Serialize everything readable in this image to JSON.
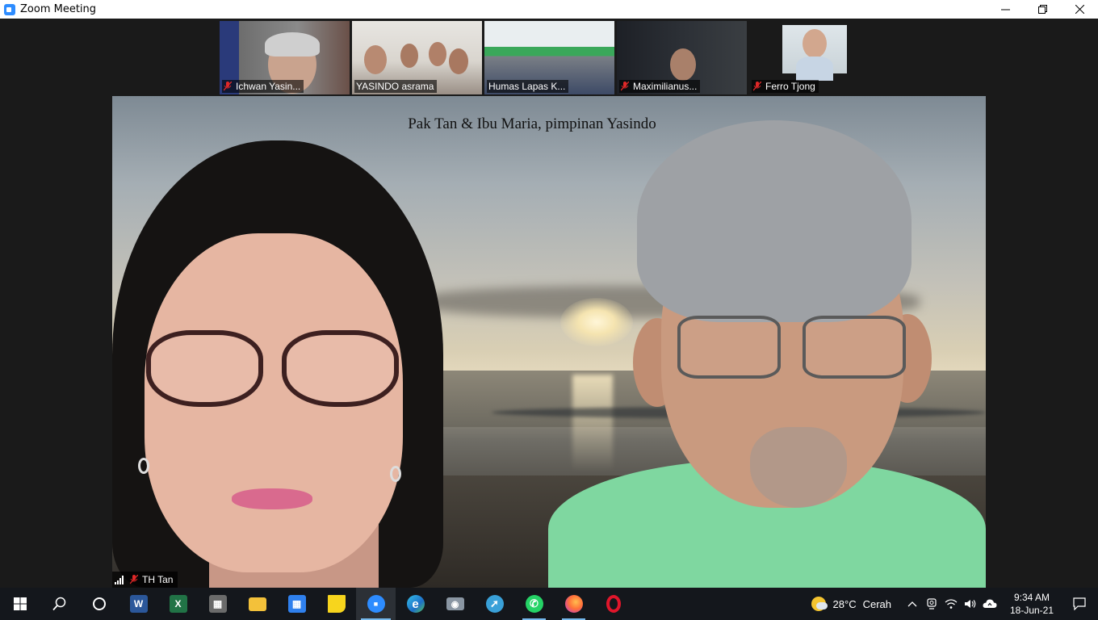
{
  "window": {
    "title": "Zoom Meeting",
    "controls": [
      "minimize-icon",
      "restore-icon",
      "close-icon"
    ]
  },
  "participants": [
    {
      "name": "Ichwan Yasin...",
      "muted": true
    },
    {
      "name": "YASINDO asrama",
      "muted": false
    },
    {
      "name": "Humas Lapas K...",
      "muted": false
    },
    {
      "name": "Maximilianus...",
      "muted": true
    },
    {
      "name": "Ferro Tjong",
      "muted": true
    }
  ],
  "main_video": {
    "caption": "Pak Tan & Ibu Maria, pimpinan Yasindo",
    "speaker": "TH Tan",
    "speaker_muted": true
  },
  "taskbar": {
    "apps": [
      {
        "name": "start-button",
        "icon": "windows-logo-icon"
      },
      {
        "name": "search-button",
        "icon": "search-icon"
      },
      {
        "name": "task-view-button",
        "icon": "cortana-circle-icon"
      },
      {
        "name": "word-app",
        "icon": "word-icon",
        "glyph": "W",
        "color": "#2b579a"
      },
      {
        "name": "excel-app",
        "icon": "excel-icon",
        "glyph": "X",
        "color": "#217346"
      },
      {
        "name": "calculator-app",
        "icon": "calculator-icon",
        "glyph": "▦",
        "color": "#6b6b6b"
      },
      {
        "name": "file-explorer-app",
        "icon": "folder-icon",
        "glyph": "",
        "color": "#f3c13a"
      },
      {
        "name": "calendar-app",
        "icon": "calendar-icon",
        "glyph": "▦",
        "color": "#2f80ed"
      },
      {
        "name": "sticky-notes-app",
        "icon": "sticky-note-icon",
        "glyph": "",
        "color": "#f7d51d"
      },
      {
        "name": "zoom-app",
        "icon": "zoom-camera-icon",
        "glyph": "■",
        "color": "#2d8cff"
      },
      {
        "name": "edge-app",
        "icon": "edge-icon",
        "glyph": "e",
        "color": "#1e90c8"
      },
      {
        "name": "camera-app",
        "icon": "camera-icon",
        "glyph": "◉",
        "color": "#8a96a3"
      },
      {
        "name": "remote-app",
        "icon": "remote-arrow-icon",
        "glyph": "➚",
        "color": "#39a0d8"
      },
      {
        "name": "whatsapp-app",
        "icon": "whatsapp-icon",
        "glyph": "✆",
        "color": "#25d366"
      },
      {
        "name": "firefox-app",
        "icon": "firefox-icon",
        "glyph": "",
        "color": "#ff7139"
      },
      {
        "name": "opera-app",
        "icon": "opera-icon",
        "glyph": "O",
        "color": "#e0162b"
      }
    ],
    "weather": {
      "temp": "28°C",
      "condition": "Cerah"
    },
    "clock": {
      "time": "9:34 AM",
      "date": "18-Jun-21"
    }
  }
}
